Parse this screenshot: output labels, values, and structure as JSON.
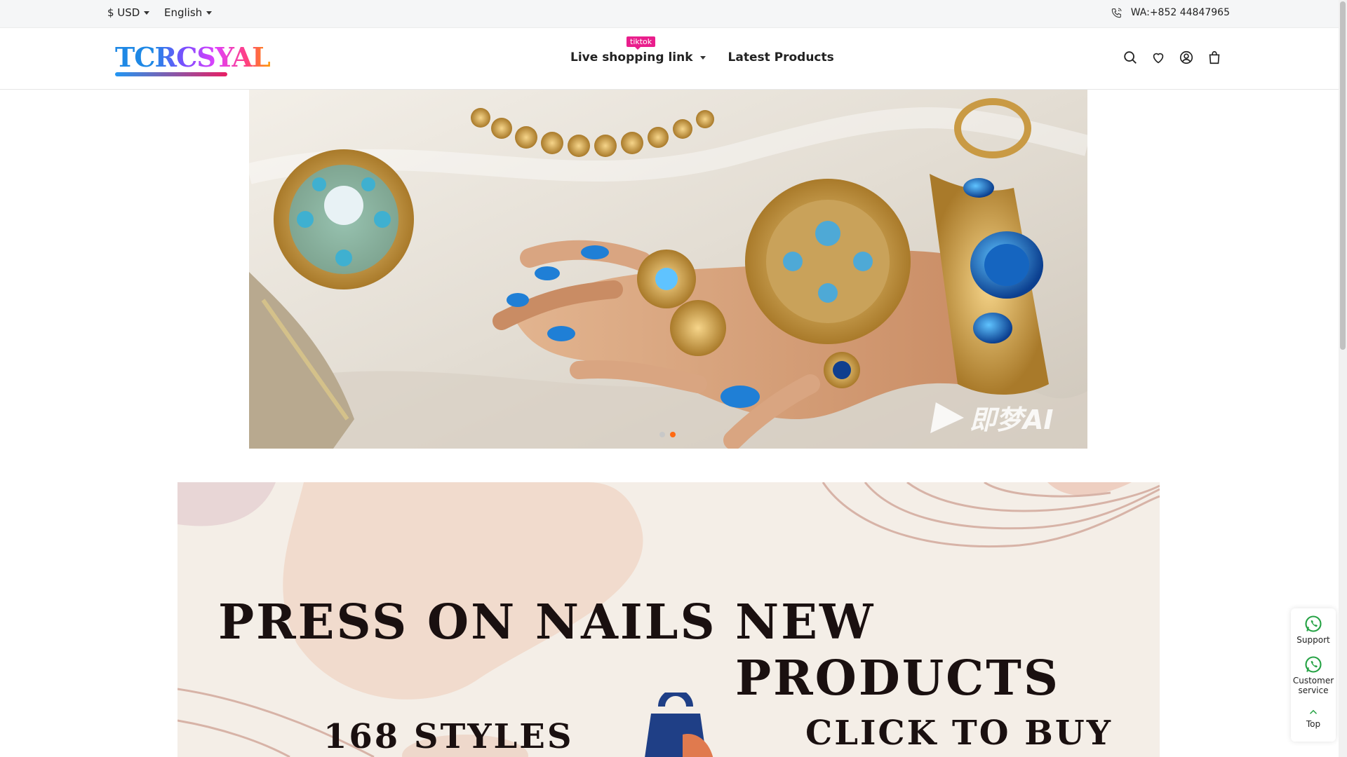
{
  "topbar": {
    "currency": "$ USD",
    "language": "English",
    "phone": "WA:+852 44847965",
    "phone_icon": "phone-icon"
  },
  "header": {
    "logo_text": "TCRCSYAL",
    "nav": [
      {
        "label": "Live shopping link",
        "badge": "tiktok",
        "has_dropdown": true
      },
      {
        "label": "Latest Products"
      }
    ],
    "icons": [
      "search-icon",
      "heart-icon",
      "account-icon",
      "cart-icon"
    ]
  },
  "hero": {
    "watermark": "即梦AI",
    "slides": 2,
    "active_slide": 2
  },
  "promo": {
    "title_left": "PRESS ON NAILS",
    "title_right": "NEW PRODUCTS",
    "subtitle_left": "168 STYLES",
    "subtitle_right": "CLICK TO BUY"
  },
  "side_widget": {
    "support": "Support",
    "customer_service": "Customer service",
    "top": "Top",
    "icon": "whatsapp-icon"
  },
  "colors": {
    "accent": "#ff6a13",
    "badge": "#e91e8c",
    "whatsapp": "#25d366"
  }
}
